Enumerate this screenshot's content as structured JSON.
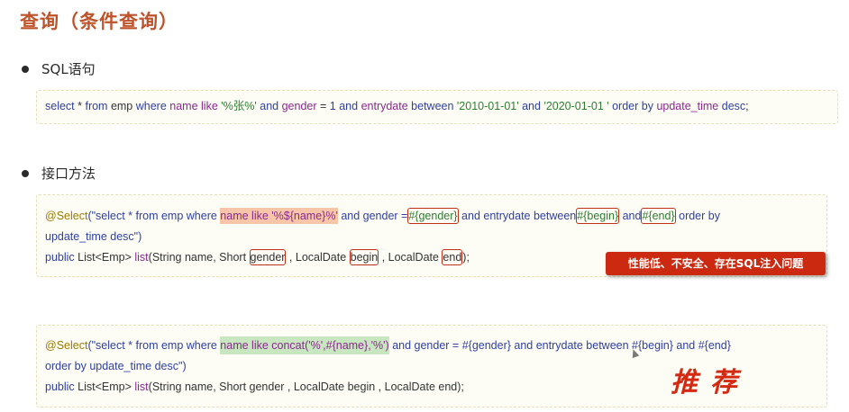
{
  "title": "查询（条件查询）",
  "sections": {
    "sql": {
      "heading": "SQL语句",
      "code": {
        "t1": "select",
        "t2": " * ",
        "t3": "from",
        "t4": " emp ",
        "t5": "where",
        "t6": " ",
        "t7": "name",
        "t8": " ",
        "t9": "like",
        "t10": " '%张%' ",
        "t11": "and",
        "t12": " ",
        "t13": "gender",
        "t14": " = ",
        "t15": "1",
        "t16": " ",
        "t17": "and",
        "t18": " ",
        "t19": "entrydate",
        "t20": " ",
        "t21": "between",
        "t22": " '2010-01-01' ",
        "t23": "and",
        "t24": " '2020-01-01 ' ",
        "t25": "order by",
        "t26": " ",
        "t27": "update_time",
        "t28": " ",
        "t29": "desc",
        "t30": ";"
      }
    },
    "interface": {
      "heading": "接口方法",
      "bad": {
        "l1": {
          "ann": "@Select",
          "p1": "(\"select * from emp where ",
          "hl": "name like '%${name}%'",
          "p2": " and gender =",
          "b1": "#{gender}",
          "p3": " and entrydate between",
          "b2": "#{begin}",
          "p4": " and",
          "b3": "#{end}",
          "p5": " order by"
        },
        "l2": "update_time desc\")",
        "l3": {
          "kw": "public",
          "p1": " List<Emp> ",
          "fn": "list",
          "p2": "(String name, Short ",
          "b1": "gender",
          "p3": " , LocalDate ",
          "b2": "begin",
          "p4": " , LocalDate ",
          "b3": "end",
          "p5": ");"
        },
        "warning": "性能低、不安全、存在SQL注入问题"
      },
      "good": {
        "l1": {
          "ann": "@Select",
          "p1": "(\"select * from emp where ",
          "hl": "name like  concat('%',#{name},'%')",
          "p2": " and gender = #{gender} and entrydate between #{begin} and #{end}"
        },
        "l2": "order by update_time desc\")",
        "l3": {
          "kw": "public",
          "p1": " List<Emp> ",
          "fn": "list",
          "p2": "(String name, Short gender , LocalDate begin , LocalDate end);"
        },
        "recommend": "推荐"
      }
    }
  },
  "colors": {
    "title": "#c0522a",
    "keyword": "#2f3fa0",
    "field": "#8a2a8f",
    "string": "#2f7d32",
    "annotation": "#9a7a00",
    "warning_bg": "#cc2a10",
    "recommend": "#d42a12"
  }
}
